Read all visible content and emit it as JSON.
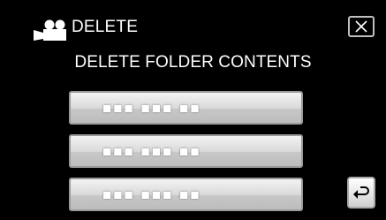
{
  "header": {
    "title": "DELETE",
    "mode_icon": "video-camera-icon"
  },
  "subtitle": "DELETE FOLDER CONTENTS",
  "folders": [
    {
      "label": "■■■ ■■■ ■■"
    },
    {
      "label": "■■■ ■■■ ■■"
    },
    {
      "label": "■■■ ■■■ ■■"
    }
  ],
  "controls": {
    "close_icon": "close-icon",
    "back_icon": "back-arrow-icon"
  }
}
